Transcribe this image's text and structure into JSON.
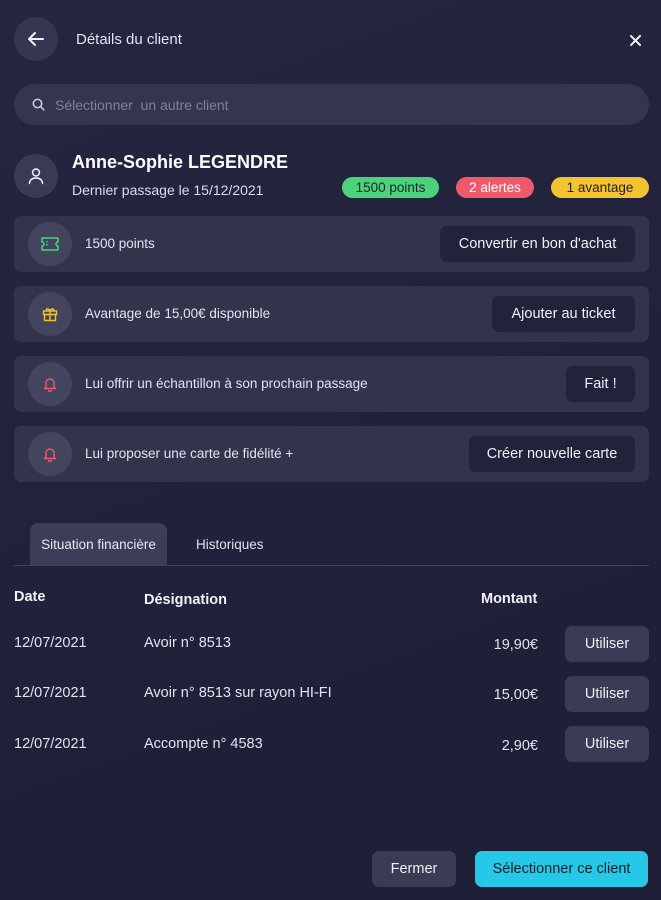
{
  "header": {
    "title": "Détails du client",
    "back_icon": "arrow-left-icon",
    "close_icon": "close-icon"
  },
  "search": {
    "placeholder": "Sélectionner  un autre client",
    "value": ""
  },
  "client": {
    "name": "Anne-Sophie LEGENDRE",
    "last_visit": "Dernier passage le 15/12/2021",
    "badges": {
      "points": "1500 points",
      "alerts": "2 alertes",
      "advantage": "1 avantage"
    }
  },
  "actions": [
    {
      "text": "1500 points",
      "button": "Convertir en bon d'achat",
      "icon": "ticket-icon"
    },
    {
      "text": "Avantage de 15,00€ disponible",
      "button": "Ajouter au ticket",
      "icon": "gift-icon"
    },
    {
      "text": "Lui offrir un échantillon à son prochain passage",
      "button": "Fait !",
      "icon": "bell-icon"
    },
    {
      "text": "Lui proposer une carte de fidélité +",
      "button": "Créer nouvelle carte",
      "icon": "bell-icon"
    }
  ],
  "tabs": {
    "active": "Situation financière",
    "other": "Historiques"
  },
  "table": {
    "headers": {
      "date": "Date",
      "designation": "Désignation",
      "amount": "Montant"
    },
    "rows": [
      {
        "date": "12/07/2021",
        "designation": "Avoir n° 8513",
        "amount": "19,90€",
        "action": "Utiliser"
      },
      {
        "date": "12/07/2021",
        "designation": "Avoir n° 8513 sur rayon HI-FI",
        "amount": "15,00€",
        "action": "Utiliser"
      },
      {
        "date": "12/07/2021",
        "designation": "Accompte n° 4583",
        "amount": "2,90€",
        "action": "Utiliser"
      }
    ]
  },
  "footer": {
    "close": "Fermer",
    "select": "Sélectionner ce client"
  },
  "colors": {
    "background": "#22233b",
    "points_badge": "#4cd27a",
    "alerts_badge": "#ef5a6a",
    "advantage_badge": "#f4c430",
    "primary_button": "#25c8e6"
  }
}
